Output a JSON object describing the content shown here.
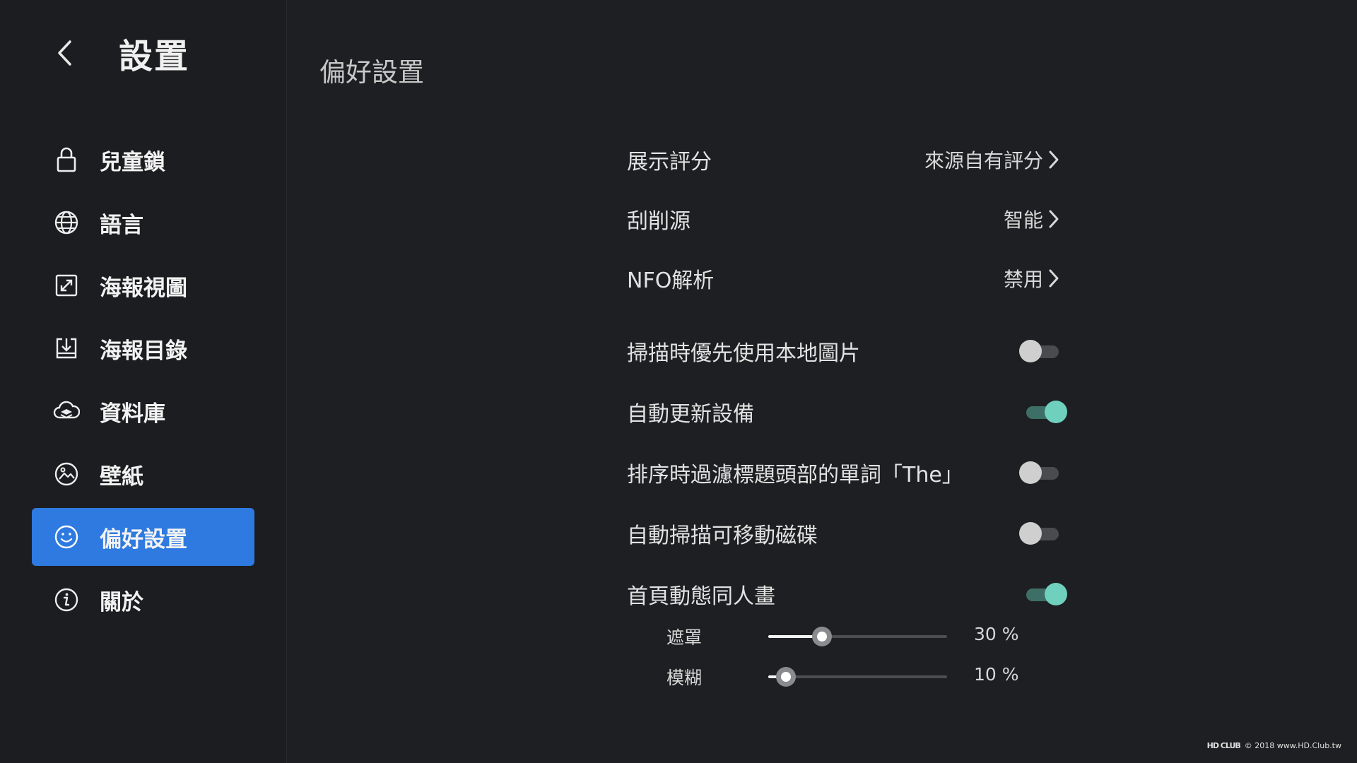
{
  "sidebar": {
    "title": "設置",
    "back_icon": "chevron-left-icon",
    "items": [
      {
        "label": "兒童鎖",
        "icon": "lock-icon",
        "active": false
      },
      {
        "label": "語言",
        "icon": "globe-icon",
        "active": false
      },
      {
        "label": "海報視圖",
        "icon": "expand-icon",
        "active": false
      },
      {
        "label": "海報目錄",
        "icon": "download-folder-icon",
        "active": false
      },
      {
        "label": "資料庫",
        "icon": "cloud-database-icon",
        "active": false
      },
      {
        "label": "壁紙",
        "icon": "image-icon",
        "active": false
      },
      {
        "label": "偏好設置",
        "icon": "smiley-icon",
        "active": true
      },
      {
        "label": "關於",
        "icon": "info-icon",
        "active": false
      }
    ],
    "active_color": "#2e7ae0"
  },
  "main": {
    "title": "偏好設置",
    "options": [
      {
        "label": "展示評分",
        "value": "來源自有評分"
      },
      {
        "label": "刮削源",
        "value": "智能"
      },
      {
        "label": "NFO解析",
        "value": "禁用"
      }
    ],
    "toggles": [
      {
        "label": "掃描時優先使用本地圖片",
        "on": false
      },
      {
        "label": "自動更新設備",
        "on": true
      },
      {
        "label": "排序時過濾標題頭部的單詞「The」",
        "on": false
      },
      {
        "label": "自動掃描可移動磁碟",
        "on": false
      },
      {
        "label": "首頁動態同人畫",
        "on": true
      }
    ],
    "sliders": [
      {
        "label": "遮罩",
        "value": 30,
        "display": "30 %"
      },
      {
        "label": "模糊",
        "value": 10,
        "display": "10 %"
      }
    ],
    "toggle_on_color": "#6fd0bd"
  },
  "watermark": {
    "logo": "HD CLUB",
    "text": "© 2018 www.HD.Club.tw"
  }
}
